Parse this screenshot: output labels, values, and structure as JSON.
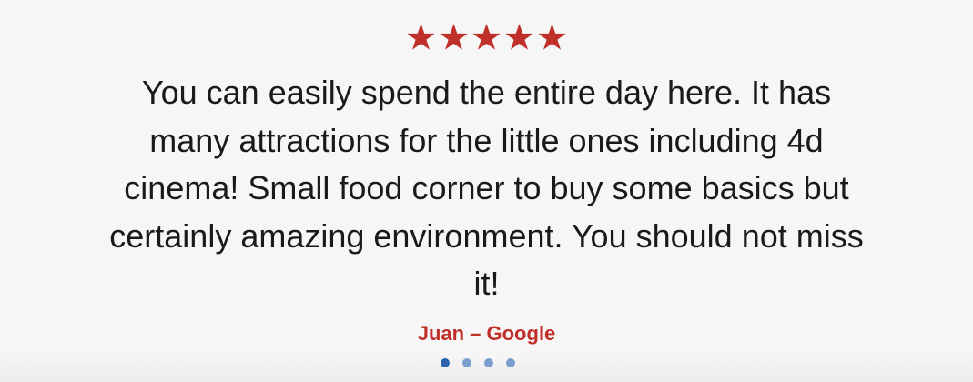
{
  "review": {
    "rating": 5,
    "max_rating": 5,
    "star_color": "#c0302a",
    "lines": [
      "You can easily spend the entire day here. It has",
      "many attractions for the little ones including 4d",
      "cinema! Small food corner to buy some basics but",
      "certainly amazing environment. You should not miss",
      "it!"
    ],
    "author": "Juan – Google"
  },
  "carousel": {
    "total": 4,
    "active_index": 0,
    "active_color": "#2b64ad",
    "inactive_color": "#7ba0cf"
  }
}
